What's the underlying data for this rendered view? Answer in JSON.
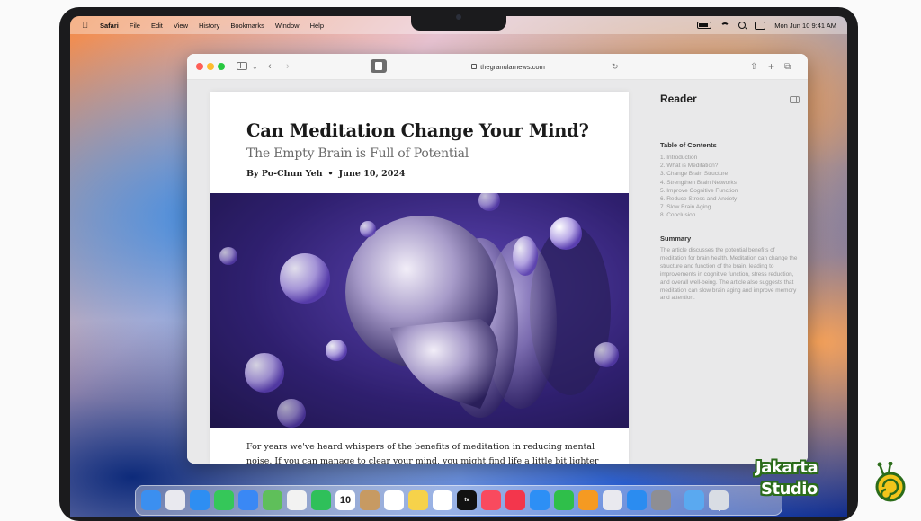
{
  "menubar": {
    "app_name": "Safari",
    "items": [
      "File",
      "Edit",
      "View",
      "History",
      "Bookmarks",
      "Window",
      "Help"
    ],
    "clock": "Mon Jun 10  9:41 AM"
  },
  "browser": {
    "url": "thegranularnews.com"
  },
  "article": {
    "title": "Can Meditation Change Your Mind?",
    "subtitle": "The Empty Brain is Full of Potential",
    "author": "By Po-Chun Yeh",
    "date": "June 10, 2024",
    "body_line1": "For years we've heard whispers of the benefits of meditation in reducing mental",
    "body_line2": "noise. If you can manage to clear your mind, you might find life a little bit lighter"
  },
  "reader": {
    "title": "Reader",
    "toc_heading": "Table of Contents",
    "toc": [
      "1.  Introduction",
      "2.  What is Meditation?",
      "3.  Change Brain Structure",
      "4.  Strengthen Brain Networks",
      "5.  Improve Cognitive Function",
      "6.  Reduce Stress and Anxiety",
      "7.  Slow Brain Aging",
      "8.  Conclusion"
    ],
    "summary_heading": "Summary",
    "summary": "The article discusses the potential benefits of meditation for brain health. Meditation can change the structure and function of the brain, leading to improvements in cognitive function, stress reduction, and overall well-being. The article also suggests that meditation can slow brain aging and improve memory and attention."
  },
  "dock": {
    "calendar_day": "10",
    "apps": [
      {
        "name": "finder-icon",
        "color": "#3b8ff0"
      },
      {
        "name": "launchpad-icon",
        "color": "#e9e9ef"
      },
      {
        "name": "safari-icon",
        "color": "#2e8ef2"
      },
      {
        "name": "messages-icon",
        "color": "#35c759"
      },
      {
        "name": "mail-icon",
        "color": "#3a88f5"
      },
      {
        "name": "maps-icon",
        "color": "#5fbf5a"
      },
      {
        "name": "photos-icon",
        "color": "#f2f2f2"
      },
      {
        "name": "facetime-icon",
        "color": "#2fc05a"
      },
      {
        "name": "calendar-icon",
        "color": "#ffffff"
      },
      {
        "name": "contacts-icon",
        "color": "#c79a62"
      },
      {
        "name": "reminders-icon",
        "color": "#ffffff"
      },
      {
        "name": "notes-icon",
        "color": "#f6d24a"
      },
      {
        "name": "freeform-icon",
        "color": "#ffffff"
      },
      {
        "name": "tv-icon",
        "color": "#111111"
      },
      {
        "name": "music-icon",
        "color": "#f94a5e"
      },
      {
        "name": "news-icon",
        "color": "#f3364c"
      },
      {
        "name": "keynote-icon",
        "color": "#2d8ff5"
      },
      {
        "name": "numbers-icon",
        "color": "#2fbf4a"
      },
      {
        "name": "pages-icon",
        "color": "#f59a22"
      },
      {
        "name": "iphone-mirroring-icon",
        "color": "#e9e9ef"
      },
      {
        "name": "app-store-icon",
        "color": "#2b8cf0"
      },
      {
        "name": "system-settings-icon",
        "color": "#8e8e93"
      },
      {
        "name": "downloads-folder-icon",
        "color": "#5aa9f0"
      },
      {
        "name": "trash-icon",
        "color": "#d9dde4"
      }
    ]
  },
  "watermark": {
    "line1": "Jakarta",
    "line2": "Studio"
  }
}
